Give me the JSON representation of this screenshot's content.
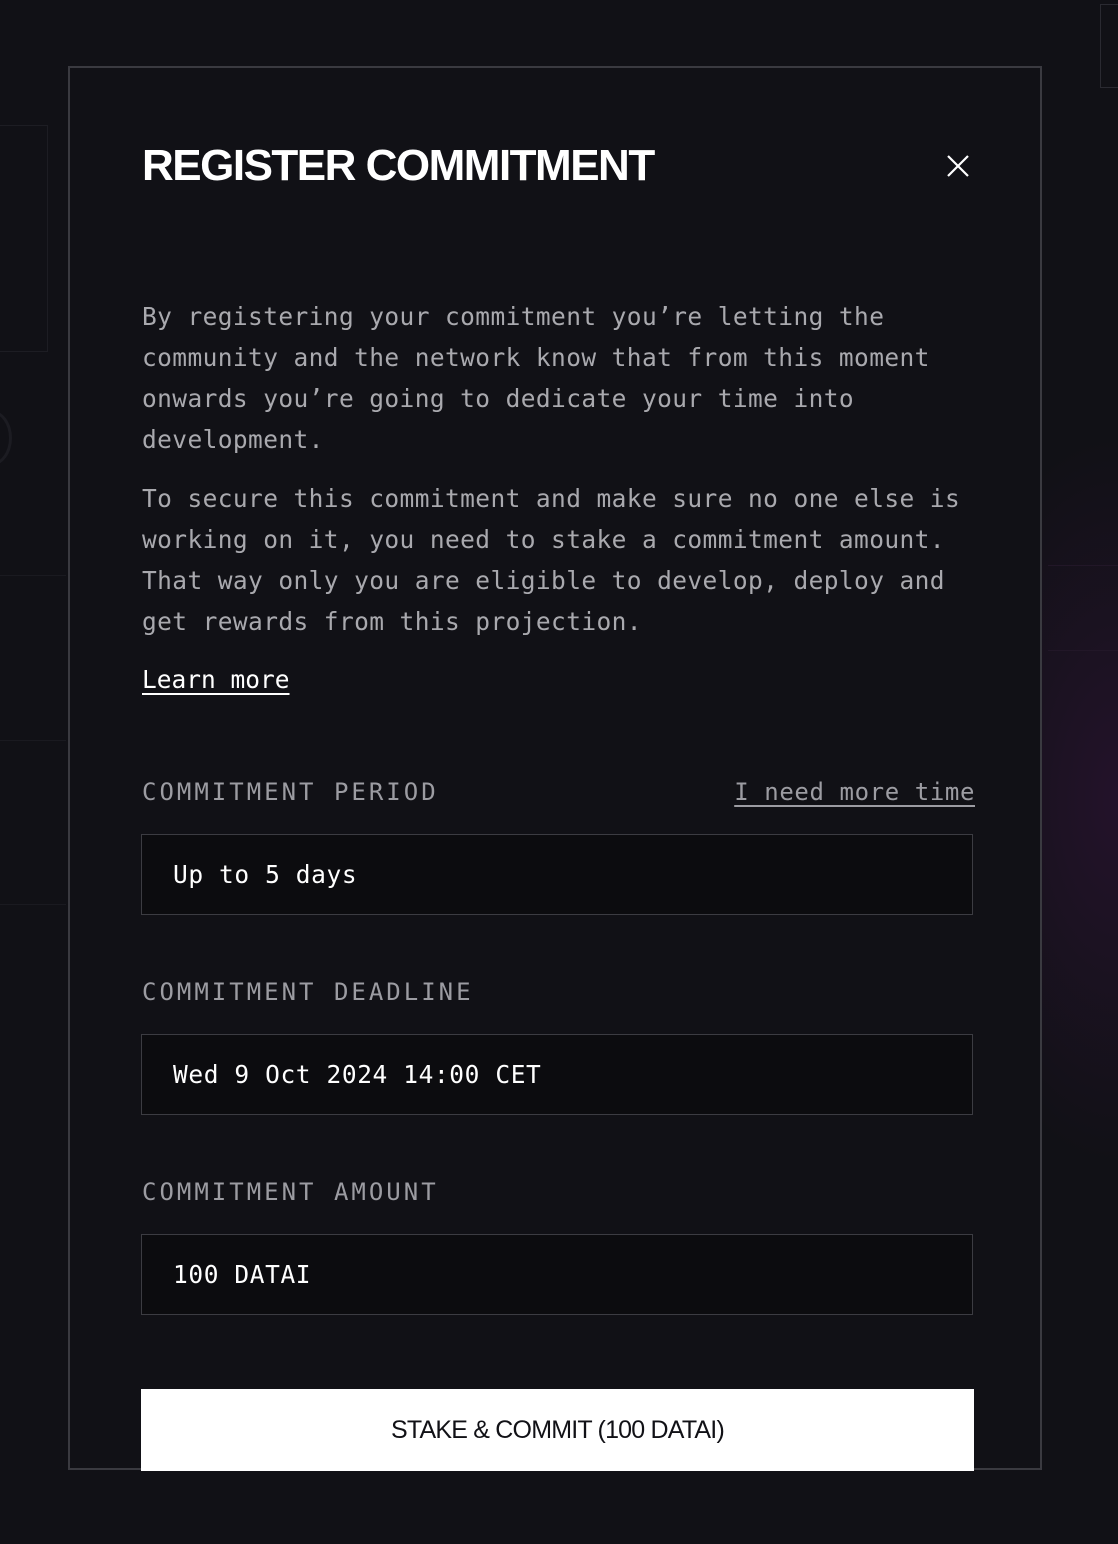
{
  "modal": {
    "title": "REGISTER COMMITMENT",
    "close_icon": "close-icon",
    "description": [
      "By registering your commitment you’re letting the community and the network know that from this moment onwards you’re going to dedicate your time into development.",
      "To secure this commitment and make sure no one else is working on it, you need to stake a commitment amount. That way only you are eligible to develop, deploy and get rewards from this projection."
    ],
    "learn_more_label": "Learn more",
    "fields": {
      "period": {
        "label": "COMMITMENT PERIOD",
        "link_label": "I need more time",
        "value": "Up to 5 days"
      },
      "deadline": {
        "label": "COMMITMENT DEADLINE",
        "value": "Wed 9 Oct 2024 14:00 CET"
      },
      "amount": {
        "label": "COMMITMENT AMOUNT",
        "value": "100 DATAI"
      }
    },
    "submit_label": "STAKE & COMMIT (100 DATAI)"
  },
  "colors": {
    "background": "#111116",
    "modal_border": "#3a3a40",
    "field_background": "#0c0c0f",
    "field_border": "#3c3c42",
    "muted_text": "#a9a9ae",
    "primary_button_bg": "#ffffff",
    "primary_button_text": "#111116"
  }
}
